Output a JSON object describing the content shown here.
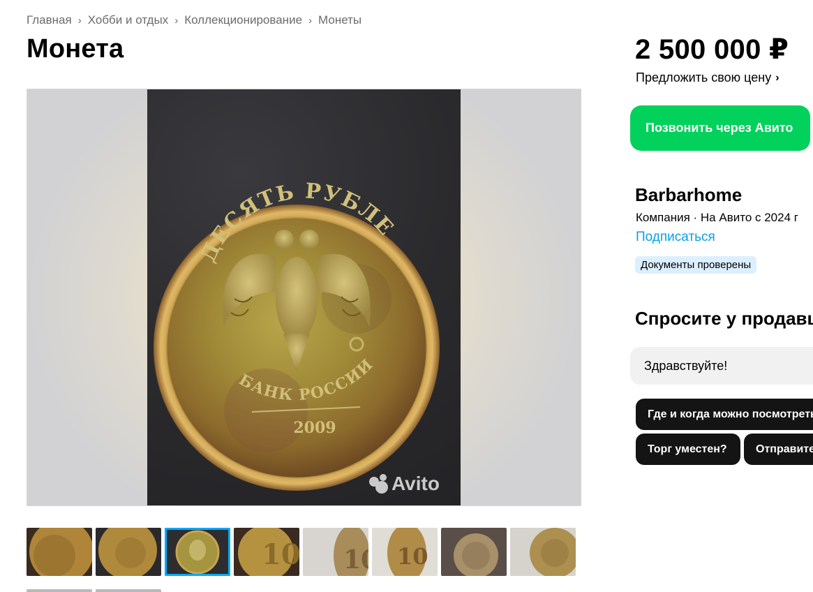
{
  "breadcrumb": {
    "items": [
      "Главная",
      "Хобби и отдых",
      "Коллекционирование",
      "Монеты"
    ]
  },
  "listing": {
    "title": "Монета",
    "price": "2 500 000 ₽",
    "offer_label": "Предложить свою цену"
  },
  "gallery": {
    "watermark": "Avito",
    "coin_text_top": "ДЕСЯТЬ РУБЛЕЙ",
    "coin_text_bottom": "БАНК РОССИИ",
    "coin_year": "2009",
    "thumbnail_count": 8,
    "active_thumbnail": 3
  },
  "actions": {
    "call_label": "Позвонить через Авито"
  },
  "seller": {
    "name": "Barbarhome",
    "meta": "Компания · На Авито с 2024 г",
    "subscribe_label": "Подписаться",
    "verified_badge": "Документы проверены"
  },
  "ask": {
    "title": "Спросите у продавца",
    "input_value": "Здравствуйте!",
    "quick_questions": [
      "Где и когда можно посмотреть?",
      "Торг уместен?",
      "Отправите?"
    ]
  },
  "colors": {
    "accent_green": "#02d15c",
    "link_blue": "#0aa0e6",
    "badge_bg": "#dcefff",
    "active_thumb": "#00aaff"
  }
}
